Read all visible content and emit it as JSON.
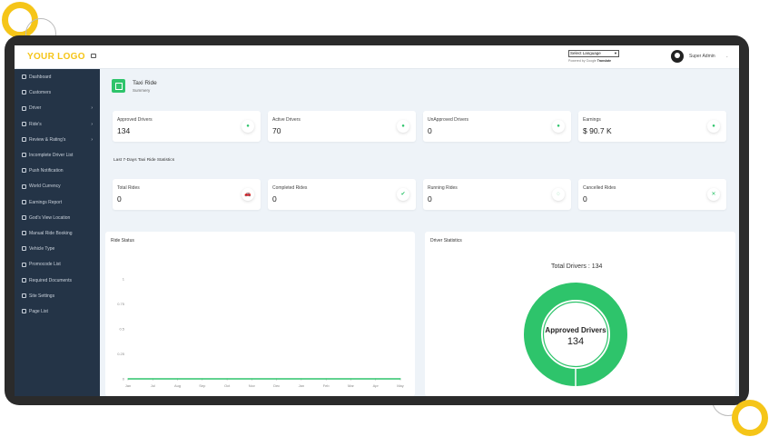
{
  "brand": {
    "logo": "YOUR LOGO"
  },
  "header": {
    "language_select": "Select Language",
    "powered_prefix": "Powered by",
    "powered_brand": "Google",
    "powered_suffix": "Translate",
    "admin_name": "Super Admin"
  },
  "sidebar": {
    "items": [
      {
        "label": "Dashboard",
        "has_sub": false
      },
      {
        "label": "Customers",
        "has_sub": false
      },
      {
        "label": "Driver",
        "has_sub": true
      },
      {
        "label": "Ride's",
        "has_sub": true
      },
      {
        "label": "Review & Rating's",
        "has_sub": true
      },
      {
        "label": "Incomplete Driver List",
        "has_sub": false
      },
      {
        "label": "Push Notification",
        "has_sub": false
      },
      {
        "label": "World Currency",
        "has_sub": false
      },
      {
        "label": "Earnings Report",
        "has_sub": false
      },
      {
        "label": "God's View Location",
        "has_sub": false
      },
      {
        "label": "Manual Ride Booking",
        "has_sub": false
      },
      {
        "label": "Vehicle Type",
        "has_sub": false
      },
      {
        "label": "Promocode List",
        "has_sub": false
      },
      {
        "label": "Required Documents",
        "has_sub": false
      },
      {
        "label": "Site Settings",
        "has_sub": false
      },
      {
        "label": "Page List",
        "has_sub": false
      }
    ]
  },
  "page": {
    "title": "Taxi Ride",
    "subtitle": "Summery"
  },
  "driver_cards": [
    {
      "label": "Approved Drivers",
      "value": "134",
      "icon": "user-icon"
    },
    {
      "label": "Active Drivers",
      "value": "70",
      "icon": "truck-icon"
    },
    {
      "label": "UnApproved Drivers",
      "value": "0",
      "icon": "user-plus-icon"
    },
    {
      "label": "Earnings",
      "value": "$ 90.7 K",
      "icon": "money-icon"
    }
  ],
  "stats_title": "Last 7-Days Taxi Ride Statistics",
  "ride_cards": [
    {
      "label": "Total Rides",
      "value": "0",
      "icon": "car-icon",
      "glyph": "🚗"
    },
    {
      "label": "Completed Rides",
      "value": "0",
      "icon": "check-icon",
      "glyph": "✔"
    },
    {
      "label": "Running Rides",
      "value": "0",
      "icon": "spinner-icon",
      "glyph": "◌"
    },
    {
      "label": "Cancelled Rides",
      "value": "0",
      "icon": "close-icon",
      "glyph": "✕"
    }
  ],
  "ride_status": {
    "title": "Ride Status",
    "chart_data": {
      "type": "line",
      "categories": [
        "Jan",
        "Jul",
        "Aug",
        "Sep",
        "Oct",
        "Nov",
        "Dec",
        "Jan",
        "Feb",
        "Mar",
        "Apr",
        "May"
      ],
      "series": [
        {
          "values": [
            0,
            0,
            0,
            0,
            0,
            0,
            0,
            0,
            0,
            0,
            0,
            0
          ]
        }
      ],
      "yticks": [
        "1",
        "0.75",
        "0.5",
        "0.25",
        "0"
      ],
      "ylim": [
        0,
        1
      ],
      "color": "#2ec46b"
    }
  },
  "driver_statistics": {
    "title": "Driver Statistics",
    "total_label": "Total Drivers : 134",
    "chart_data": {
      "type": "pie",
      "slices": [
        {
          "label": "Approved Drivers",
          "value": 134
        }
      ],
      "center_label": "Approved Drivers",
      "center_value": "134",
      "color": "#2ec46b"
    }
  }
}
